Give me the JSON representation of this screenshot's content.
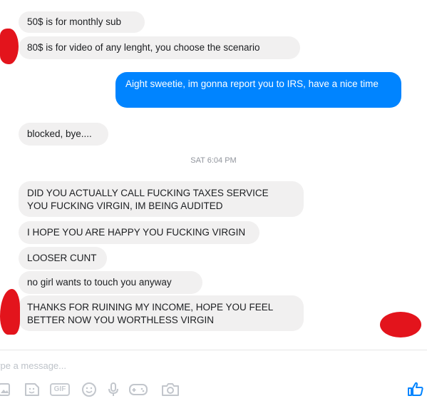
{
  "messages": [
    {
      "text": "50$ is for monthly sub"
    },
    {
      "text": "80$ is for video of any lenght, you choose the scenario"
    },
    {
      "text": "Aight sweetie, im gonna report you to IRS, have a nice time"
    },
    {
      "text": "blocked, bye...."
    },
    {
      "text": "DID YOU ACTUALLY CALL FUCKING TAXES SERVICE\nYOU FUCKING VIRGIN, IM BEING AUDITED"
    },
    {
      "text": "I HOPE YOU ARE HAPPY YOU FUCKING VIRGIN"
    },
    {
      "text": "LOOSER CUNT"
    },
    {
      "text": "no girl wants to touch you anyway"
    },
    {
      "text": "THANKS FOR RUINING MY INCOME, HOPE YOU FEEL\nBETTER NOW YOU WORTHLESS VIRGIN"
    }
  ],
  "timestamp": "SAT 6:04 PM",
  "composer": {
    "placeholder": "ype a message...",
    "gif_label": "GIF",
    "tools": [
      "image-icon",
      "sticker-icon",
      "gif-icon",
      "emoji-icon",
      "microphone-icon",
      "game-icon",
      "camera-icon"
    ],
    "send_icon": "thumbs-up-icon"
  },
  "colors": {
    "incoming_bubble": "#f1f0f0",
    "outgoing_bubble": "#0084ff",
    "redaction": "#e3141c"
  }
}
